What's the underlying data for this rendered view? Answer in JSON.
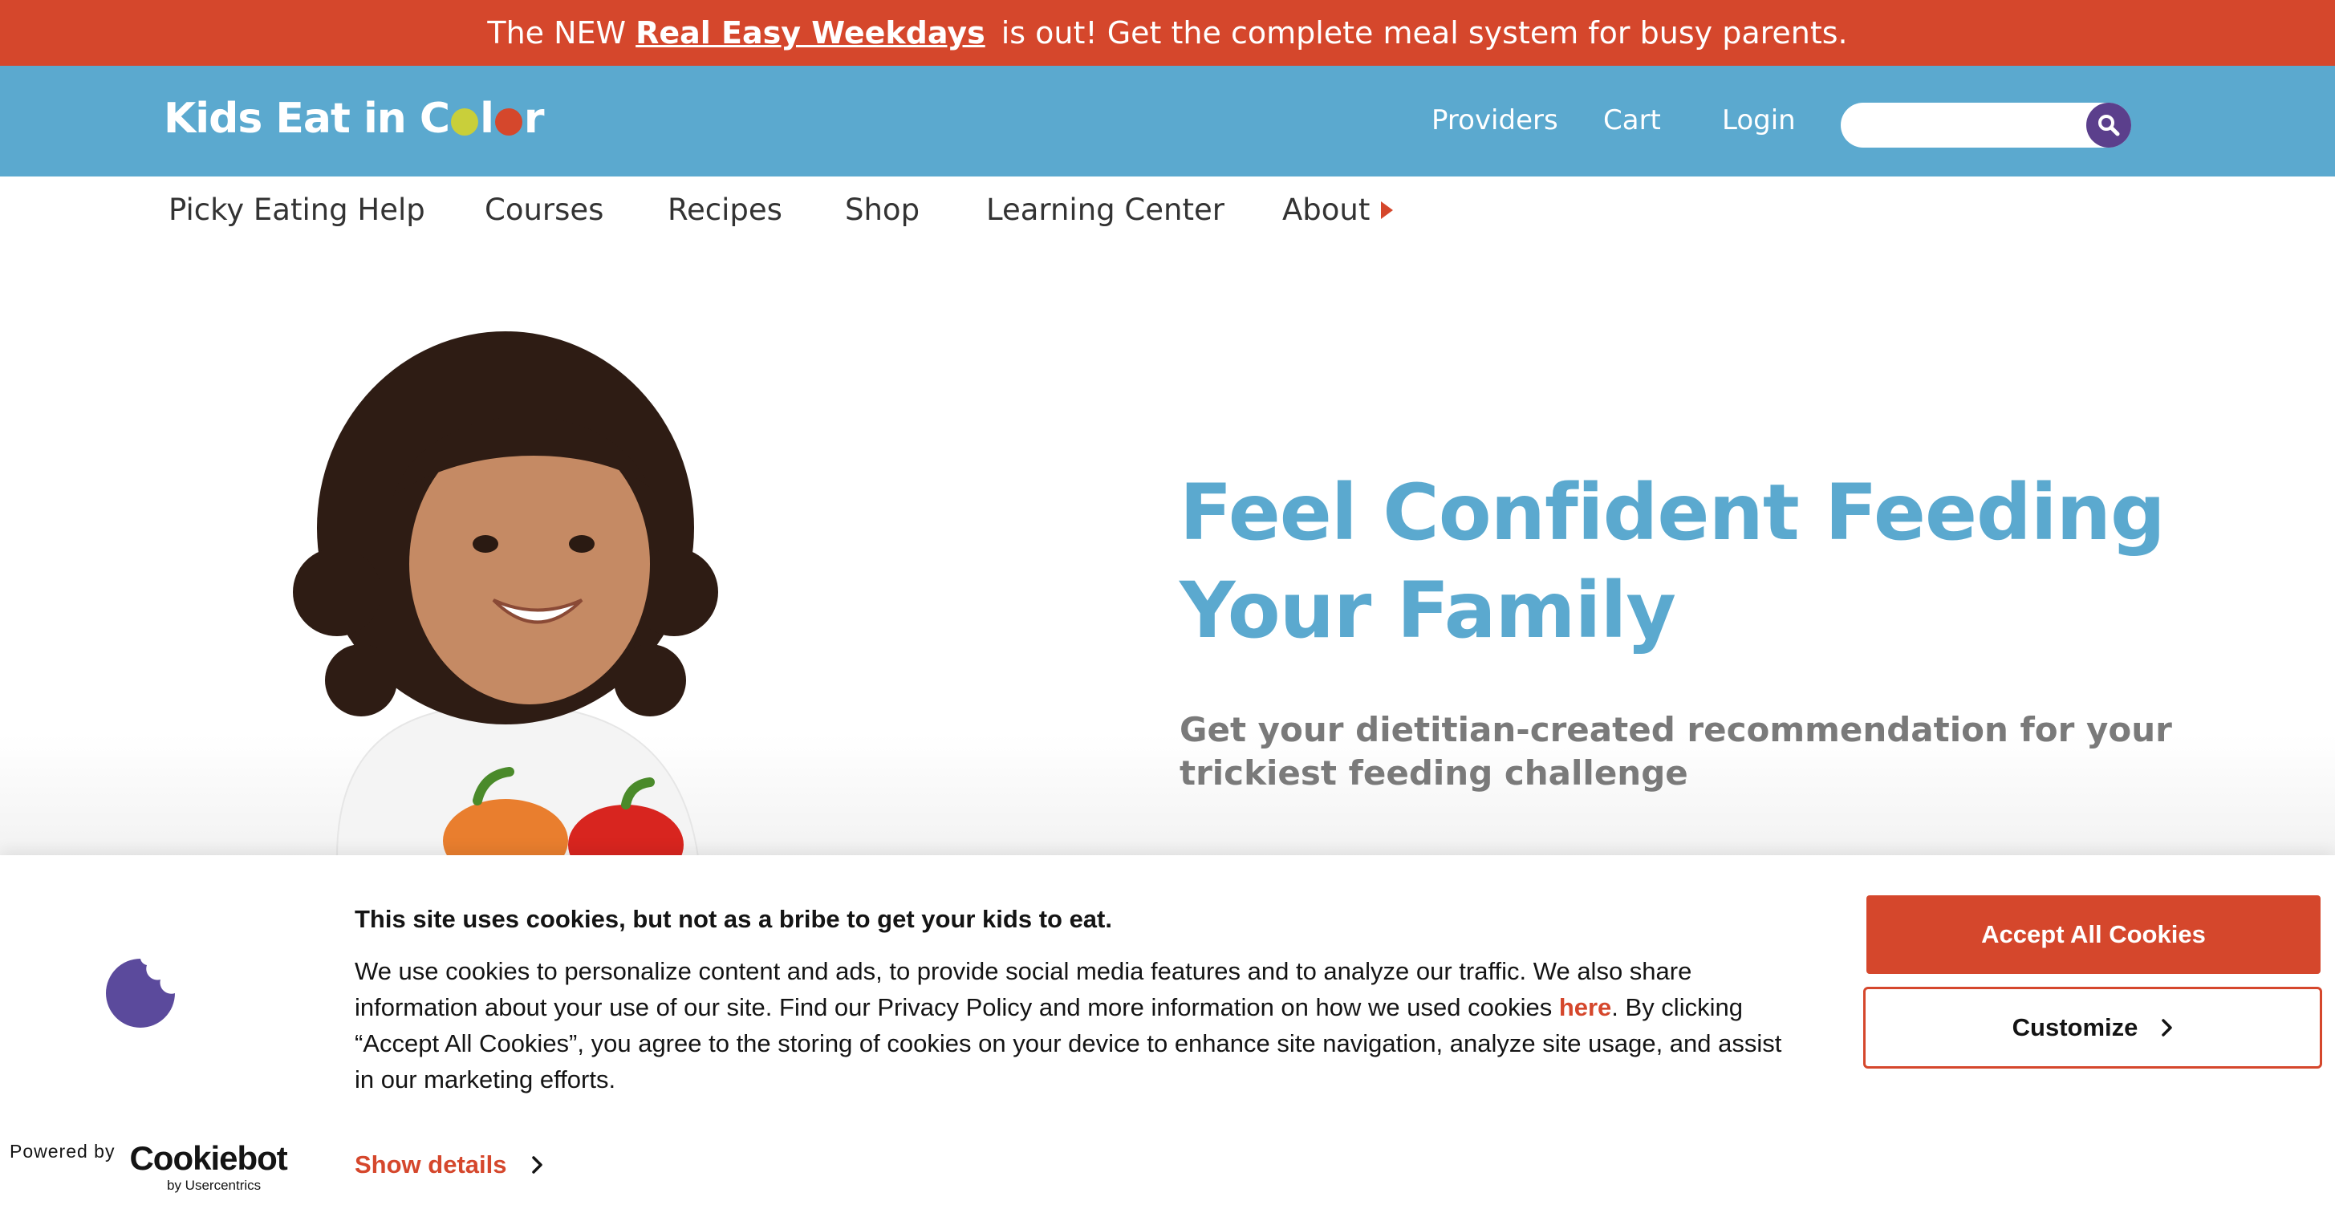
{
  "promo": {
    "prefix": "The NEW",
    "link": "Real Easy Weekdays",
    "suffix": "is out! Get the complete meal system for busy parents."
  },
  "header": {
    "logo": {
      "part1": "Kids Eat in C",
      "part2": "l",
      "part3": "r"
    },
    "links": [
      "Providers",
      "Cart",
      "Login"
    ],
    "search_placeholder": ""
  },
  "nav": {
    "items": [
      "Picky Eating Help",
      "Courses",
      "Recipes",
      "Shop",
      "Learning Center",
      "About"
    ]
  },
  "hero": {
    "title": "Feel Confident Feeding Your Family",
    "subtitle": "Get your dietitian-created recommendation for your trickiest feeding challenge"
  },
  "cookie": {
    "title": "This site uses cookies, but not as a bribe to get your kids to eat.",
    "body_before": "We use cookies to personalize content and ads, to provide social media features and to analyze our traffic. We also share information about your use of our site. Find our Privacy Policy and more information on how we used cookies ",
    "body_link": "here",
    "body_after": ". By clicking “Accept All Cookies”, you agree to the storing of cookies on your device to enhance site navigation, analyze site usage, and assist in our marketing efforts.",
    "show_details": "Show details",
    "accept": "Accept All Cookies",
    "customize": "Customize",
    "powered_by": "Powered by",
    "brand": "Cookiebot",
    "brand_sub": "by Usercentrics"
  },
  "colors": {
    "accent_red": "#d5472c",
    "header_blue": "#5ba9cf",
    "search_purple": "#5b3f8c",
    "subtitle_gray": "#7a7a7a"
  }
}
